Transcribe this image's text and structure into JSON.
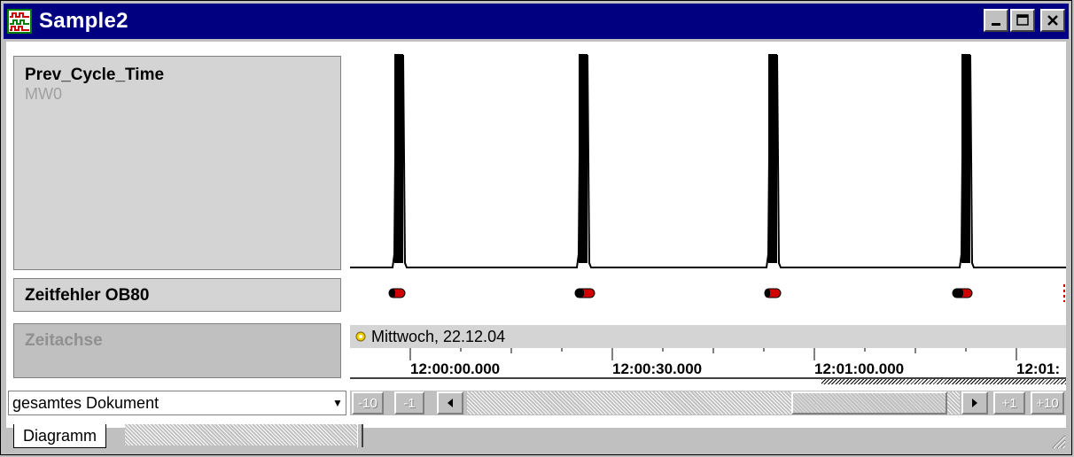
{
  "window": {
    "title": "Sample2",
    "buttons": {
      "minimize": "minimize-icon",
      "maximize": "maximize-icon",
      "close": "close-icon"
    }
  },
  "signals": [
    {
      "name": "Prev_Cycle_Time",
      "address": "MW0"
    },
    {
      "name": "Zeitfehler OB80"
    },
    {
      "name": "Zeitachse"
    }
  ],
  "timeline": {
    "date_label": "Mittwoch, 22.12.04",
    "ticks": [
      "12:00:00.000",
      "12:00:30.000",
      "12:01:00.000",
      "12:01:"
    ]
  },
  "range_select": {
    "value": "gesamtes Dokument"
  },
  "scroll_buttons": {
    "minus10": "-10",
    "minus1": "-1",
    "plus1": "+1",
    "plus10": "+10"
  },
  "tabs": [
    {
      "label": "Diagramm"
    }
  ],
  "colors": {
    "titlebar": "#000080",
    "event_red": "#d00000",
    "panel": "#d4d4d4"
  }
}
